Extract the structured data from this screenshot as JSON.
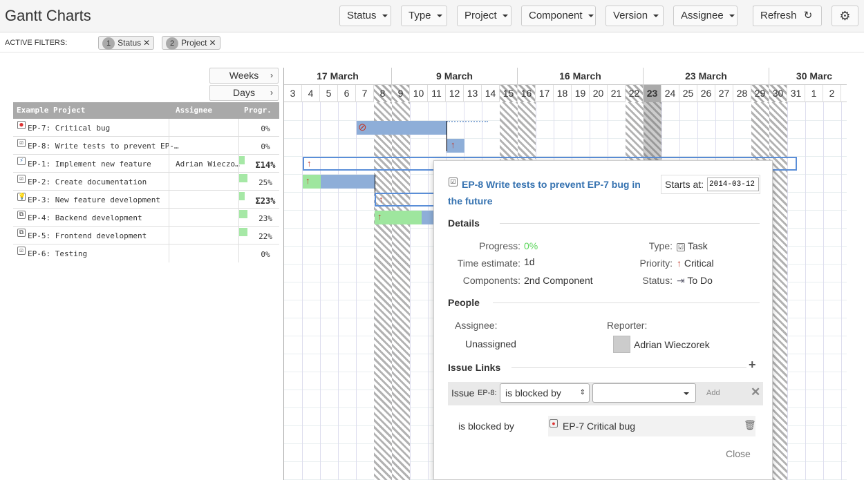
{
  "header": {
    "title": "Gantt Charts",
    "filters": [
      "Status",
      "Type",
      "Project",
      "Component",
      "Version",
      "Assignee"
    ],
    "refresh_label": "Refresh"
  },
  "active_filters": {
    "label": "ACTIVE FILTERS:",
    "chips": [
      {
        "count": "1",
        "label": "Status"
      },
      {
        "count": "2",
        "label": "Project"
      }
    ]
  },
  "view": {
    "weeks_label": "Weeks",
    "days_label": "Days"
  },
  "table": {
    "headers": {
      "name": "Example Project",
      "assignee": "Assignee",
      "progress": "Progr."
    },
    "rows": [
      {
        "key": "EP-7: Critical bug",
        "assignee": "",
        "progress": "0%",
        "icon": "bug-icon"
      },
      {
        "key": "EP-8: Write tests to prevent EP-…",
        "assignee": "",
        "progress": "0%",
        "icon": "task-icon"
      },
      {
        "key": "EP-1: Implement new feature",
        "assignee": "Adrian Wieczo…",
        "progress": "Σ14%",
        "icon": "epic-icon"
      },
      {
        "key": "EP-2: Create documentation",
        "assignee": "",
        "progress": "25%",
        "icon": "task-icon"
      },
      {
        "key": "EP-3: New feature development",
        "assignee": "",
        "progress": "Σ23%",
        "icon": "feature-icon"
      },
      {
        "key": "EP-4: Backend development",
        "assignee": "",
        "progress": "23%",
        "icon": "subtask-icon"
      },
      {
        "key": "EP-5: Frontend development",
        "assignee": "",
        "progress": "22%",
        "icon": "subtask-icon"
      },
      {
        "key": "EP-6: Testing",
        "assignee": "",
        "progress": "0%",
        "icon": "task-icon"
      }
    ]
  },
  "timeline": {
    "months": [
      "17 March",
      "9 March",
      "16 March",
      "23 March",
      "30 Marc"
    ],
    "days": [
      "3",
      "4",
      "5",
      "6",
      "7",
      "8",
      "9",
      "10",
      "11",
      "12",
      "13",
      "14",
      "15",
      "16",
      "17",
      "18",
      "19",
      "20",
      "21",
      "22",
      "23",
      "24",
      "25",
      "26",
      "27",
      "28",
      "29",
      "30",
      "31",
      "1",
      "2"
    ]
  },
  "popup": {
    "title": "EP-8 Write tests to prevent EP-7 bug in the future",
    "starts_label": "Starts at:",
    "starts_value": "2014-03-12",
    "details_heading": "Details",
    "progress_label": "Progress:",
    "progress_value": "0%",
    "estimate_label": "Time estimate:",
    "estimate_value": "1d",
    "components_label": "Components:",
    "components_value": "2nd Component",
    "type_label": "Type:",
    "type_value": "Task",
    "priority_label": "Priority:",
    "priority_value": "Critical",
    "status_label": "Status:",
    "status_value": "To Do",
    "people_heading": "People",
    "assignee_label": "Assignee:",
    "assignee_value": "Unassigned",
    "reporter_label": "Reporter:",
    "reporter_value": "Adrian Wieczorek",
    "links_heading": "Issue Links",
    "issue_label": "Issue",
    "issue_key": "EP-8:",
    "link_type": "is blocked by",
    "add_label": "Add",
    "blocked_label": "is blocked by",
    "blocked_issue": "EP-7 Critical bug",
    "close_label": "Close"
  },
  "colors": {
    "accent": "#3572b0",
    "progress_green": "#5cd65c",
    "bar_blue": "#8eaed8",
    "priority_red": "#c0392b"
  }
}
